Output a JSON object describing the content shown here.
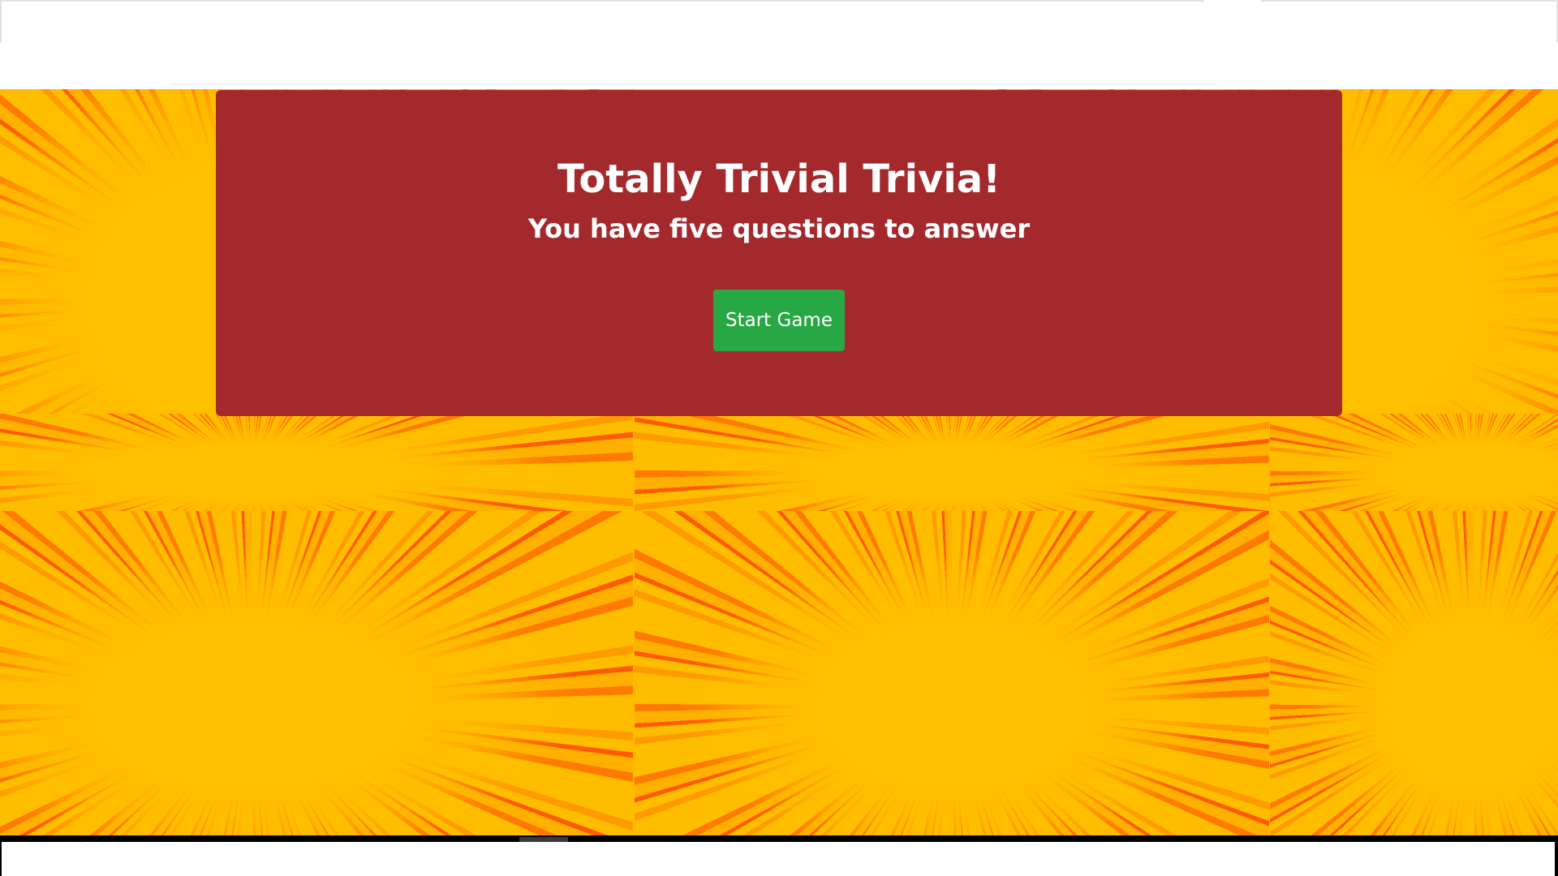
{
  "hero": {
    "title": "Totally Trivial Trivia!",
    "subtitle": "You have five questions to answer",
    "start_button_label": "Start Game"
  },
  "colors": {
    "hero_background": "#a4292d",
    "start_button": "#28a745",
    "burst_yellow": "#ffbd00",
    "burst_orange": "#ff7a00",
    "burst_red": "#ff5a00"
  },
  "background": {
    "pattern": "sunburst-rays"
  }
}
